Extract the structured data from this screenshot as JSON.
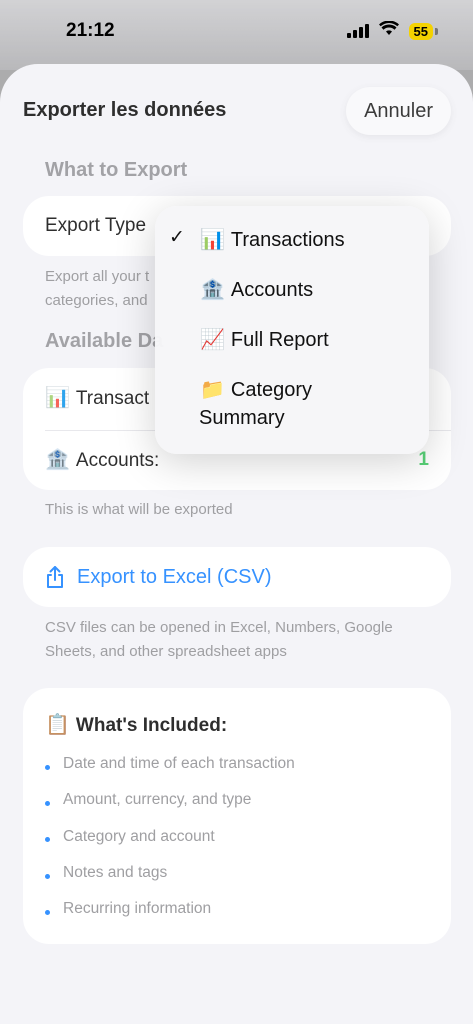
{
  "status": {
    "time": "21:12",
    "battery": "55"
  },
  "sheet": {
    "title": "Exporter les données",
    "cancel_label": "Annuler"
  },
  "what_to_export": {
    "section_title": "What to Export",
    "export_type_label": "Export Type",
    "footnote_line1": "Export all your t",
    "footnote_line2": "categories, and"
  },
  "available": {
    "section_title": "Available Da",
    "rows": [
      {
        "emoji": "📊",
        "label": "Transact",
        "value": ""
      },
      {
        "emoji": "🏦",
        "label": "Accounts:",
        "value": "1"
      }
    ],
    "footnote": "This is what will be exported"
  },
  "export_button": {
    "label": "Export to Excel (CSV)",
    "icon": "share-icon"
  },
  "csv_note": "CSV files can be opened in Excel, Numbers, Google Sheets, and other spreadsheet apps",
  "included": {
    "emoji": "📋",
    "title": "What's Included:",
    "items": [
      "Date and time of each transaction",
      "Amount, currency, and type",
      "Category and account",
      "Notes and tags",
      "Recurring information"
    ]
  },
  "menu": {
    "items": [
      {
        "emoji": "📊",
        "label": "Transactions",
        "checked": true
      },
      {
        "emoji": "🏦",
        "label": "Accounts",
        "checked": false
      },
      {
        "emoji": "📈",
        "label": "Full Report",
        "checked": false
      },
      {
        "emoji": "📁",
        "label": "Category",
        "label_line2": "Summary",
        "checked": false
      }
    ],
    "check_glyph": "✓"
  },
  "colors": {
    "accent": "#0a7aff",
    "success": "#34c759",
    "battery": "#f4d200"
  }
}
